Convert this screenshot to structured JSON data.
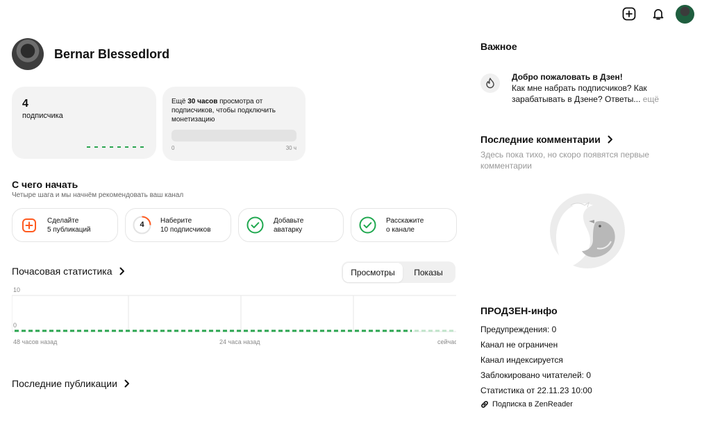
{
  "topbar": {
    "add_icon": "plus-square-icon",
    "bell_icon": "bell-icon"
  },
  "channel": {
    "name": "Bernar Blessedlord"
  },
  "subscribers": {
    "count": "4",
    "label": "подписчика"
  },
  "monetization": {
    "text_prefix": "Ещё ",
    "text_bold": "30 часов",
    "text_suffix": " просмотра от подписчиков, чтобы подключить монетизацию",
    "min_label": "0",
    "max_label": "30 ч",
    "progress": 0
  },
  "start": {
    "title": "С чего начать",
    "subtitle": "Четыре шага и мы начнём рекомендовать ваш канал",
    "steps": [
      {
        "line1": "Сделайте",
        "line2": "5 публикаций",
        "icon": "plus-square-icon"
      },
      {
        "line1": "Наберите",
        "line2": "10 подписчиков",
        "icon": "progress-ring-icon",
        "badge": "4"
      },
      {
        "line1": "Добавьте",
        "line2": "аватарку",
        "icon": "check-circle-icon"
      },
      {
        "line1": "Расскажите",
        "line2": "о канале",
        "icon": "check-circle-icon"
      }
    ]
  },
  "hourly": {
    "title": "Почасовая статистика",
    "tabs": [
      "Просмотры",
      "Показы"
    ],
    "active_tab": 0,
    "y_max": "10",
    "y_min": "0",
    "x_labels": [
      "48 часов назад",
      "24 часа назад",
      "сейчас"
    ]
  },
  "recent_pubs": {
    "title": "Последние публикации"
  },
  "important": {
    "title": "Важное",
    "headline": "Добро пожаловать в Дзен!",
    "body": "Как мне набрать подписчиков? Как зарабатывать в Дзене? Ответы...",
    "more": "ещё"
  },
  "comments": {
    "title": "Последние комментарии",
    "empty_text": "Здесь пока тихо, но скоро появятся первые комментарии"
  },
  "prodzen": {
    "title": "ПРОДЗЕН-инфо",
    "lines": [
      "Предупреждения: 0",
      "Канал не ограничен",
      "Канал индексируется",
      "Заблокировано читателей: 0",
      "Статистика от 22.11.23 10:00"
    ],
    "link": "Подписка в ZenReader"
  },
  "colors": {
    "accent_orange": "#ff5a1f",
    "accent_green": "#1fa84f",
    "chart_green": "#2aa44f"
  }
}
